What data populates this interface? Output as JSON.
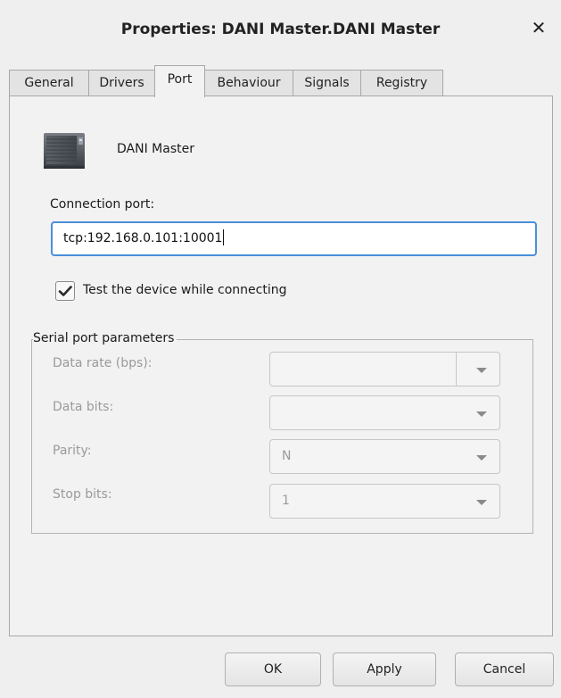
{
  "window": {
    "title": "Properties: DANI Master.DANI Master",
    "close_glyph": "✕"
  },
  "tabs": [
    {
      "label": "General",
      "active": false
    },
    {
      "label": "Drivers",
      "active": false
    },
    {
      "label": "Port",
      "active": true
    },
    {
      "label": "Behaviour",
      "active": false
    },
    {
      "label": "Signals",
      "active": false
    },
    {
      "label": "Registry",
      "active": false
    }
  ],
  "device": {
    "icon": "device-icon",
    "name": "DANI Master"
  },
  "connection": {
    "label": "Connection port:",
    "value": "tcp:192.168.0.101:10001"
  },
  "test_device": {
    "label": "Test the device while connecting",
    "checked": true
  },
  "serial": {
    "title": "Serial port parameters",
    "fields": [
      {
        "label": "Data rate (bps):",
        "value": ""
      },
      {
        "label": "Data bits:",
        "value": ""
      },
      {
        "label": "Parity:",
        "value": "N"
      },
      {
        "label": "Stop bits:",
        "value": "1"
      }
    ]
  },
  "buttons": {
    "ok": "OK",
    "apply": "Apply",
    "cancel": "Cancel"
  },
  "colors": {
    "focus_border": "#4a90d9",
    "window_bg": "#efefef",
    "disabled_text": "#9a9a9a"
  }
}
